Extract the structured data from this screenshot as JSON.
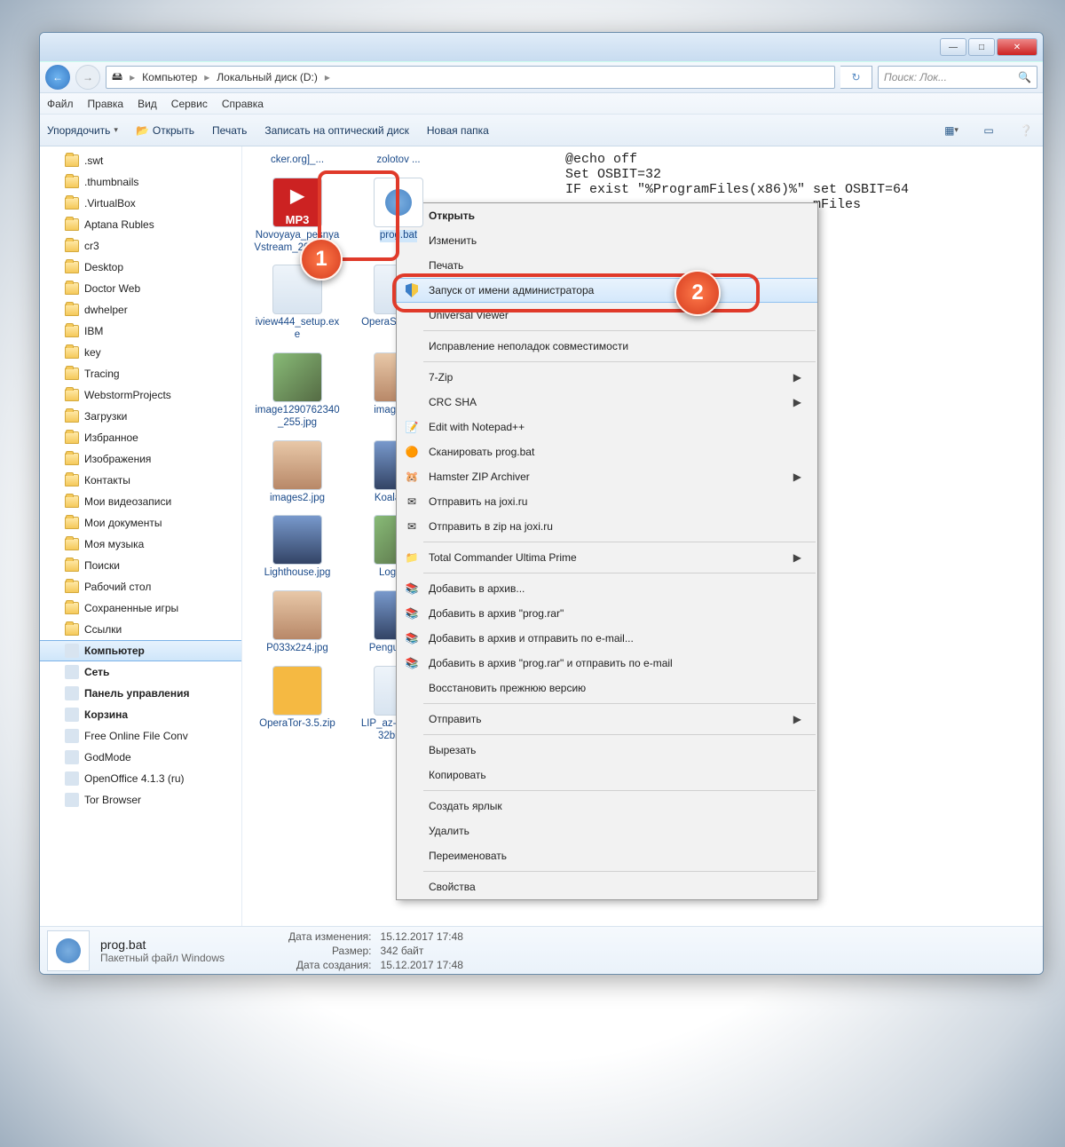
{
  "titlebar": {
    "min": "—",
    "max": "□",
    "close": "✕"
  },
  "address": {
    "root": "Компьютер",
    "path2": "Локальный диск (D:)"
  },
  "search": {
    "placeholder": "Поиск: Лок..."
  },
  "menubar": [
    "Файл",
    "Правка",
    "Вид",
    "Сервис",
    "Справка"
  ],
  "toolbar": {
    "organize": "Упорядочить",
    "open": "Открыть",
    "print": "Печать",
    "burn": "Записать на оптический диск",
    "newfolder": "Новая папка"
  },
  "tree": [
    {
      "label": ".swt",
      "icon": "folder"
    },
    {
      "label": ".thumbnails",
      "icon": "folder"
    },
    {
      "label": ".VirtualBox",
      "icon": "folder"
    },
    {
      "label": "Aptana Rubles",
      "icon": "folder"
    },
    {
      "label": "cr3",
      "icon": "folder"
    },
    {
      "label": "Desktop",
      "icon": "folder"
    },
    {
      "label": "Doctor Web",
      "icon": "folder"
    },
    {
      "label": "dwhelper",
      "icon": "folder"
    },
    {
      "label": "IBM",
      "icon": "folder"
    },
    {
      "label": "key",
      "icon": "folder"
    },
    {
      "label": "Tracing",
      "icon": "folder"
    },
    {
      "label": "WebstormProjects",
      "icon": "folder"
    },
    {
      "label": "Загрузки",
      "icon": "folder"
    },
    {
      "label": "Избранное",
      "icon": "folder"
    },
    {
      "label": "Изображения",
      "icon": "folder"
    },
    {
      "label": "Контакты",
      "icon": "folder"
    },
    {
      "label": "Мои видеозаписи",
      "icon": "folder"
    },
    {
      "label": "Мои документы",
      "icon": "folder"
    },
    {
      "label": "Моя музыка",
      "icon": "folder"
    },
    {
      "label": "Поиски",
      "icon": "folder"
    },
    {
      "label": "Рабочий стол",
      "icon": "folder"
    },
    {
      "label": "Сохраненные игры",
      "icon": "folder"
    },
    {
      "label": "Ссылки",
      "icon": "folder"
    },
    {
      "label": "Компьютер",
      "icon": "pc",
      "selected": true,
      "bold": true
    },
    {
      "label": "Сеть",
      "icon": "pc",
      "bold": true
    },
    {
      "label": "Панель управления",
      "icon": "pc",
      "bold": true
    },
    {
      "label": "Корзина",
      "icon": "pc",
      "bold": true
    },
    {
      "label": "Free Online File Conv",
      "icon": "pc"
    },
    {
      "label": "GodMode",
      "icon": "pc"
    },
    {
      "label": "OpenOffice 4.1.3 (ru)",
      "icon": "pc"
    },
    {
      "label": "Tor Browser",
      "icon": "pc"
    }
  ],
  "files_top": [
    {
      "name": "cker.org]_...",
      "type": "exe"
    },
    {
      "name": "zolotov ...",
      "type": "exe"
    }
  ],
  "files": [
    {
      "name": "Novoyaya_pesnyaVstream_2012_g...",
      "type": "mp3"
    },
    {
      "name": "prog.bat",
      "type": "bat",
      "selected": true
    },
    {
      "name": "iview444_setup.exe",
      "type": "exe"
    },
    {
      "name": "OperaSetup.exe",
      "type": "exe"
    },
    {
      "name": "image1290762340_255.jpg",
      "type": "img"
    },
    {
      "name": "images.jpg",
      "type": "photo1"
    },
    {
      "name": "images2.jpg",
      "type": "photo1"
    },
    {
      "name": "Koala3.jpg",
      "type": "photo2"
    },
    {
      "name": "Lighthouse.jpg",
      "type": "photo2"
    },
    {
      "name": "Logo.jpg",
      "type": "img"
    },
    {
      "name": "P033x2z4.jpg",
      "type": "photo1"
    },
    {
      "name": "Penguins.jpg",
      "type": "photo2"
    },
    {
      "name": "OperaTor-3.5.zip",
      "type": "zip"
    },
    {
      "name": "LIP_az-Latn-AZ-32bit.mlc",
      "type": "exe"
    }
  ],
  "preview": "@echo off\nSet OSBIT=32\nIF exist \"%ProgramFiles(x86)%\" set OSBIT=64\n                               mFiles",
  "context_menu": [
    {
      "label": "Открыть",
      "bold": true
    },
    {
      "label": "Изменить"
    },
    {
      "label": "Печать"
    },
    {
      "label": "Запуск от имени администратора",
      "icon": "shield",
      "hl": true
    },
    {
      "label": "Universal Viewer"
    },
    {
      "sep": true
    },
    {
      "label": "Исправление неполадок совместимости"
    },
    {
      "sep": true
    },
    {
      "label": "7-Zip",
      "arrow": true
    },
    {
      "label": "CRC SHA",
      "arrow": true
    },
    {
      "label": "Edit with Notepad++",
      "icon": "npp"
    },
    {
      "label": "Сканировать prog.bat",
      "icon": "av"
    },
    {
      "label": "Hamster ZIP Archiver",
      "icon": "ham",
      "arrow": true
    },
    {
      "label": "Отправить на joxi.ru",
      "icon": "joxi"
    },
    {
      "label": "Отправить в zip на joxi.ru",
      "icon": "joxi"
    },
    {
      "sep": true
    },
    {
      "label": "Total Commander Ultima Prime",
      "icon": "tc",
      "arrow": true
    },
    {
      "sep": true
    },
    {
      "label": "Добавить в архив...",
      "icon": "rar"
    },
    {
      "label": "Добавить в архив \"prog.rar\"",
      "icon": "rar"
    },
    {
      "label": "Добавить в архив и отправить по e-mail...",
      "icon": "rar"
    },
    {
      "label": "Добавить в архив \"prog.rar\" и отправить по e-mail",
      "icon": "rar"
    },
    {
      "label": "Восстановить прежнюю версию"
    },
    {
      "sep": true
    },
    {
      "label": "Отправить",
      "arrow": true
    },
    {
      "sep": true
    },
    {
      "label": "Вырезать"
    },
    {
      "label": "Копировать"
    },
    {
      "sep": true
    },
    {
      "label": "Создать ярлык"
    },
    {
      "label": "Удалить"
    },
    {
      "label": "Переименовать"
    },
    {
      "sep": true
    },
    {
      "label": "Свойства"
    }
  ],
  "statusbar": {
    "filename": "prog.bat",
    "filetype": "Пакетный файл Windows",
    "k_modified": "Дата изменения:",
    "v_modified": "15.12.2017 17:48",
    "k_size": "Размер:",
    "v_size": "342 байт",
    "k_created": "Дата создания:",
    "v_created": "15.12.2017 17:48"
  },
  "callouts": {
    "one": "1",
    "two": "2"
  }
}
